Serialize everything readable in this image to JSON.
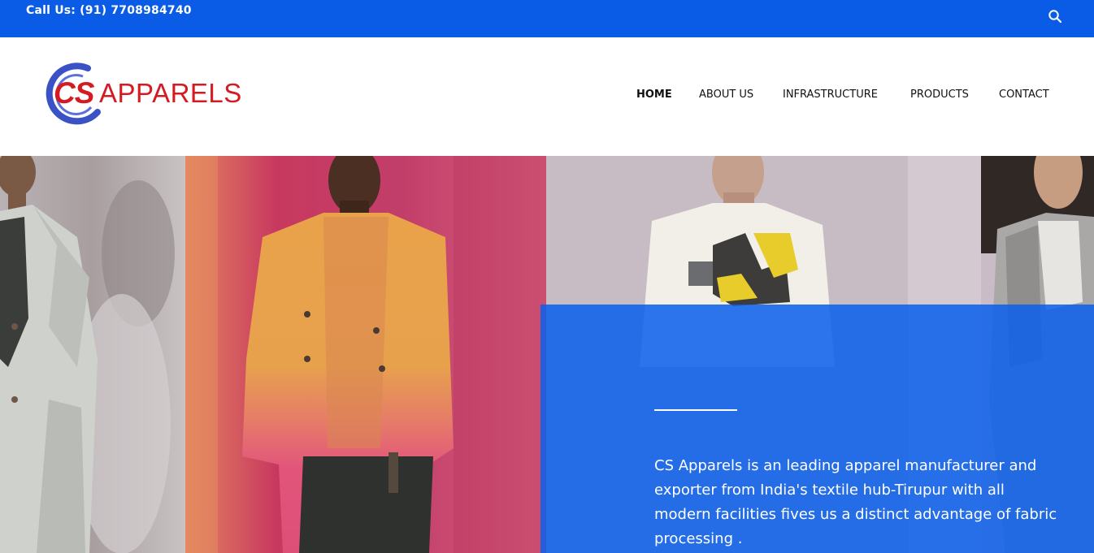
{
  "topbar": {
    "call_text": "Call Us: (91) 7708984740",
    "search_icon": "search-icon"
  },
  "logo": {
    "cs": "CS",
    "apparels": "APPARELS",
    "colors": {
      "red": "#d51b22",
      "blue": "#3b52c7"
    }
  },
  "nav": {
    "items": [
      {
        "label": "HOME",
        "active": true
      },
      {
        "label": "ABOUT US",
        "active": false
      },
      {
        "label": "INFRASTRUCTURE",
        "active": false
      },
      {
        "label": "PRODUCTS",
        "active": false
      },
      {
        "label": "CONTACT",
        "active": false
      }
    ]
  },
  "hero": {
    "description": "CS Apparels is an leading apparel manufacturer and exporter from India's textile hub-Tirupur with all modern facilities fives us a distinct advantage of fabric processing ."
  },
  "colors": {
    "accent": "#0a5ce6",
    "overlay": "#0a5feb"
  }
}
